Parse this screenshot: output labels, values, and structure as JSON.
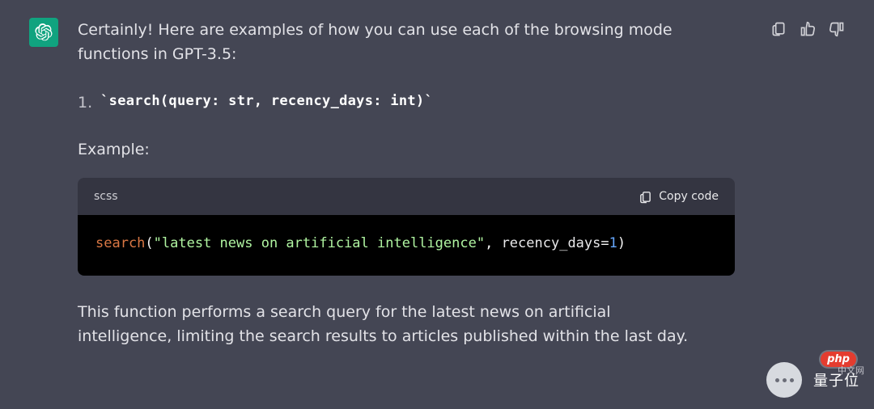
{
  "message": {
    "intro": "Certainly! Here are examples of how you can use each of the browsing mode functions in GPT-3.5:",
    "list_number": "1.",
    "signature": "`search(query: str, recency_days: int)`",
    "example_label": "Example:",
    "desc": "This function performs a search query for the latest news on artificial intelligence, limiting the search results to articles published within the last day."
  },
  "code": {
    "lang": "scss",
    "copy_label": "Copy code",
    "fn": "search",
    "open": "(",
    "str": "\"latest news on artificial intelligence\"",
    "sep": ", ",
    "argname": "recency_days",
    "eq": "=",
    "num": "1",
    "close": ")"
  },
  "overlay": {
    "php": "php",
    "php_sub": "中文网",
    "author": "量子位"
  }
}
